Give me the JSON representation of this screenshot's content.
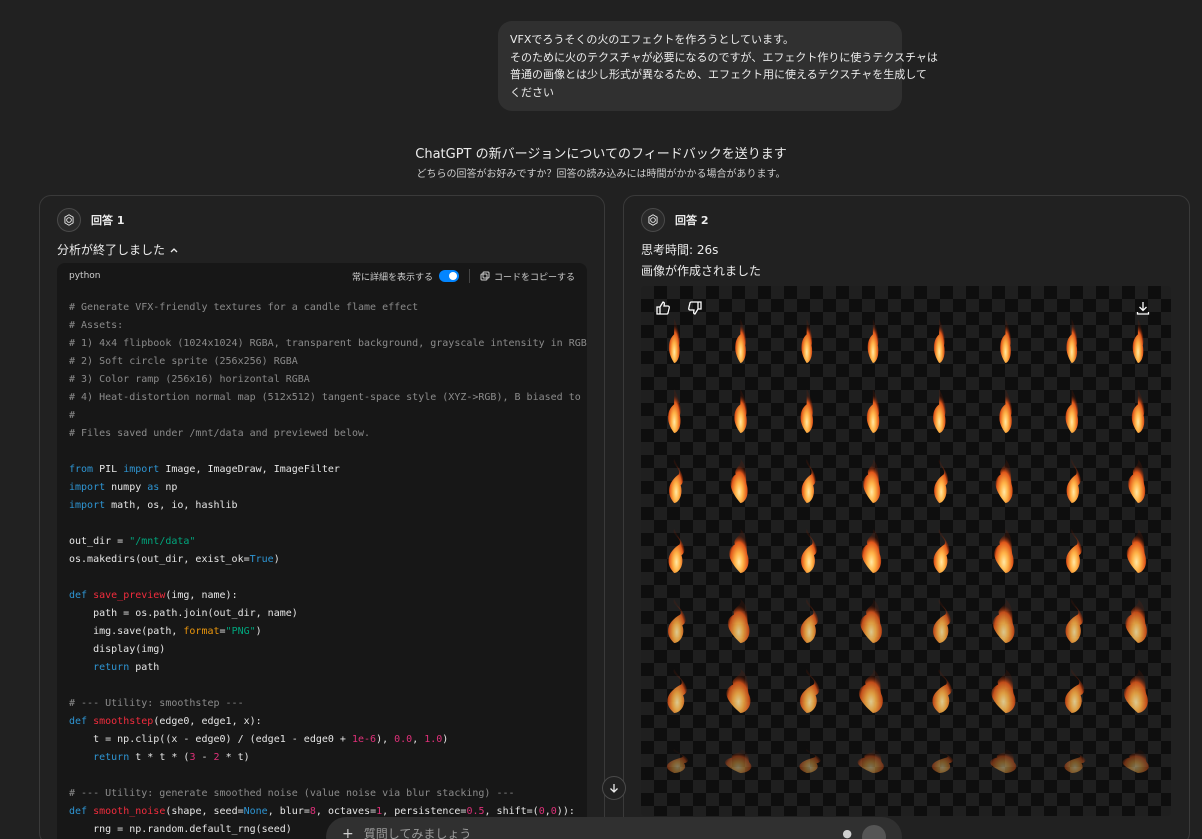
{
  "user_message": {
    "lines": [
      "VFXでろうそくの火のエフェクトを作ろうとしています。",
      "そのために火のテクスチャが必要になるのですが、エフェクト作りに使うテクスチャは",
      "普通の画像とは少し形式が異なるため、エフェクト用に使えるテクスチャを生成して",
      "ください"
    ]
  },
  "feedback": {
    "title": "ChatGPT の新バージョンについてのフィードバックを送ります",
    "subtitle": "どちらの回答がお好みですか？回答の読み込みには時間がかかる場合があります。"
  },
  "response1": {
    "label": "回答 1",
    "status": "分析が終了しました",
    "code": {
      "language": "python",
      "show_details_label": "常に詳細を表示する",
      "copy_label": "コードをコピーする"
    }
  },
  "response2": {
    "label": "回答 2",
    "thinking_time": "思考時間: 26s",
    "image_created": "画像が作成されました",
    "flame_grid": {
      "rows": 7,
      "cols": 8
    }
  },
  "composer": {
    "placeholder": "質問してみましょう"
  },
  "colors": {
    "background": "#212121",
    "accent": "#0285ff",
    "flame_core": "#ffd36b",
    "flame_outer": "#e0561a"
  }
}
